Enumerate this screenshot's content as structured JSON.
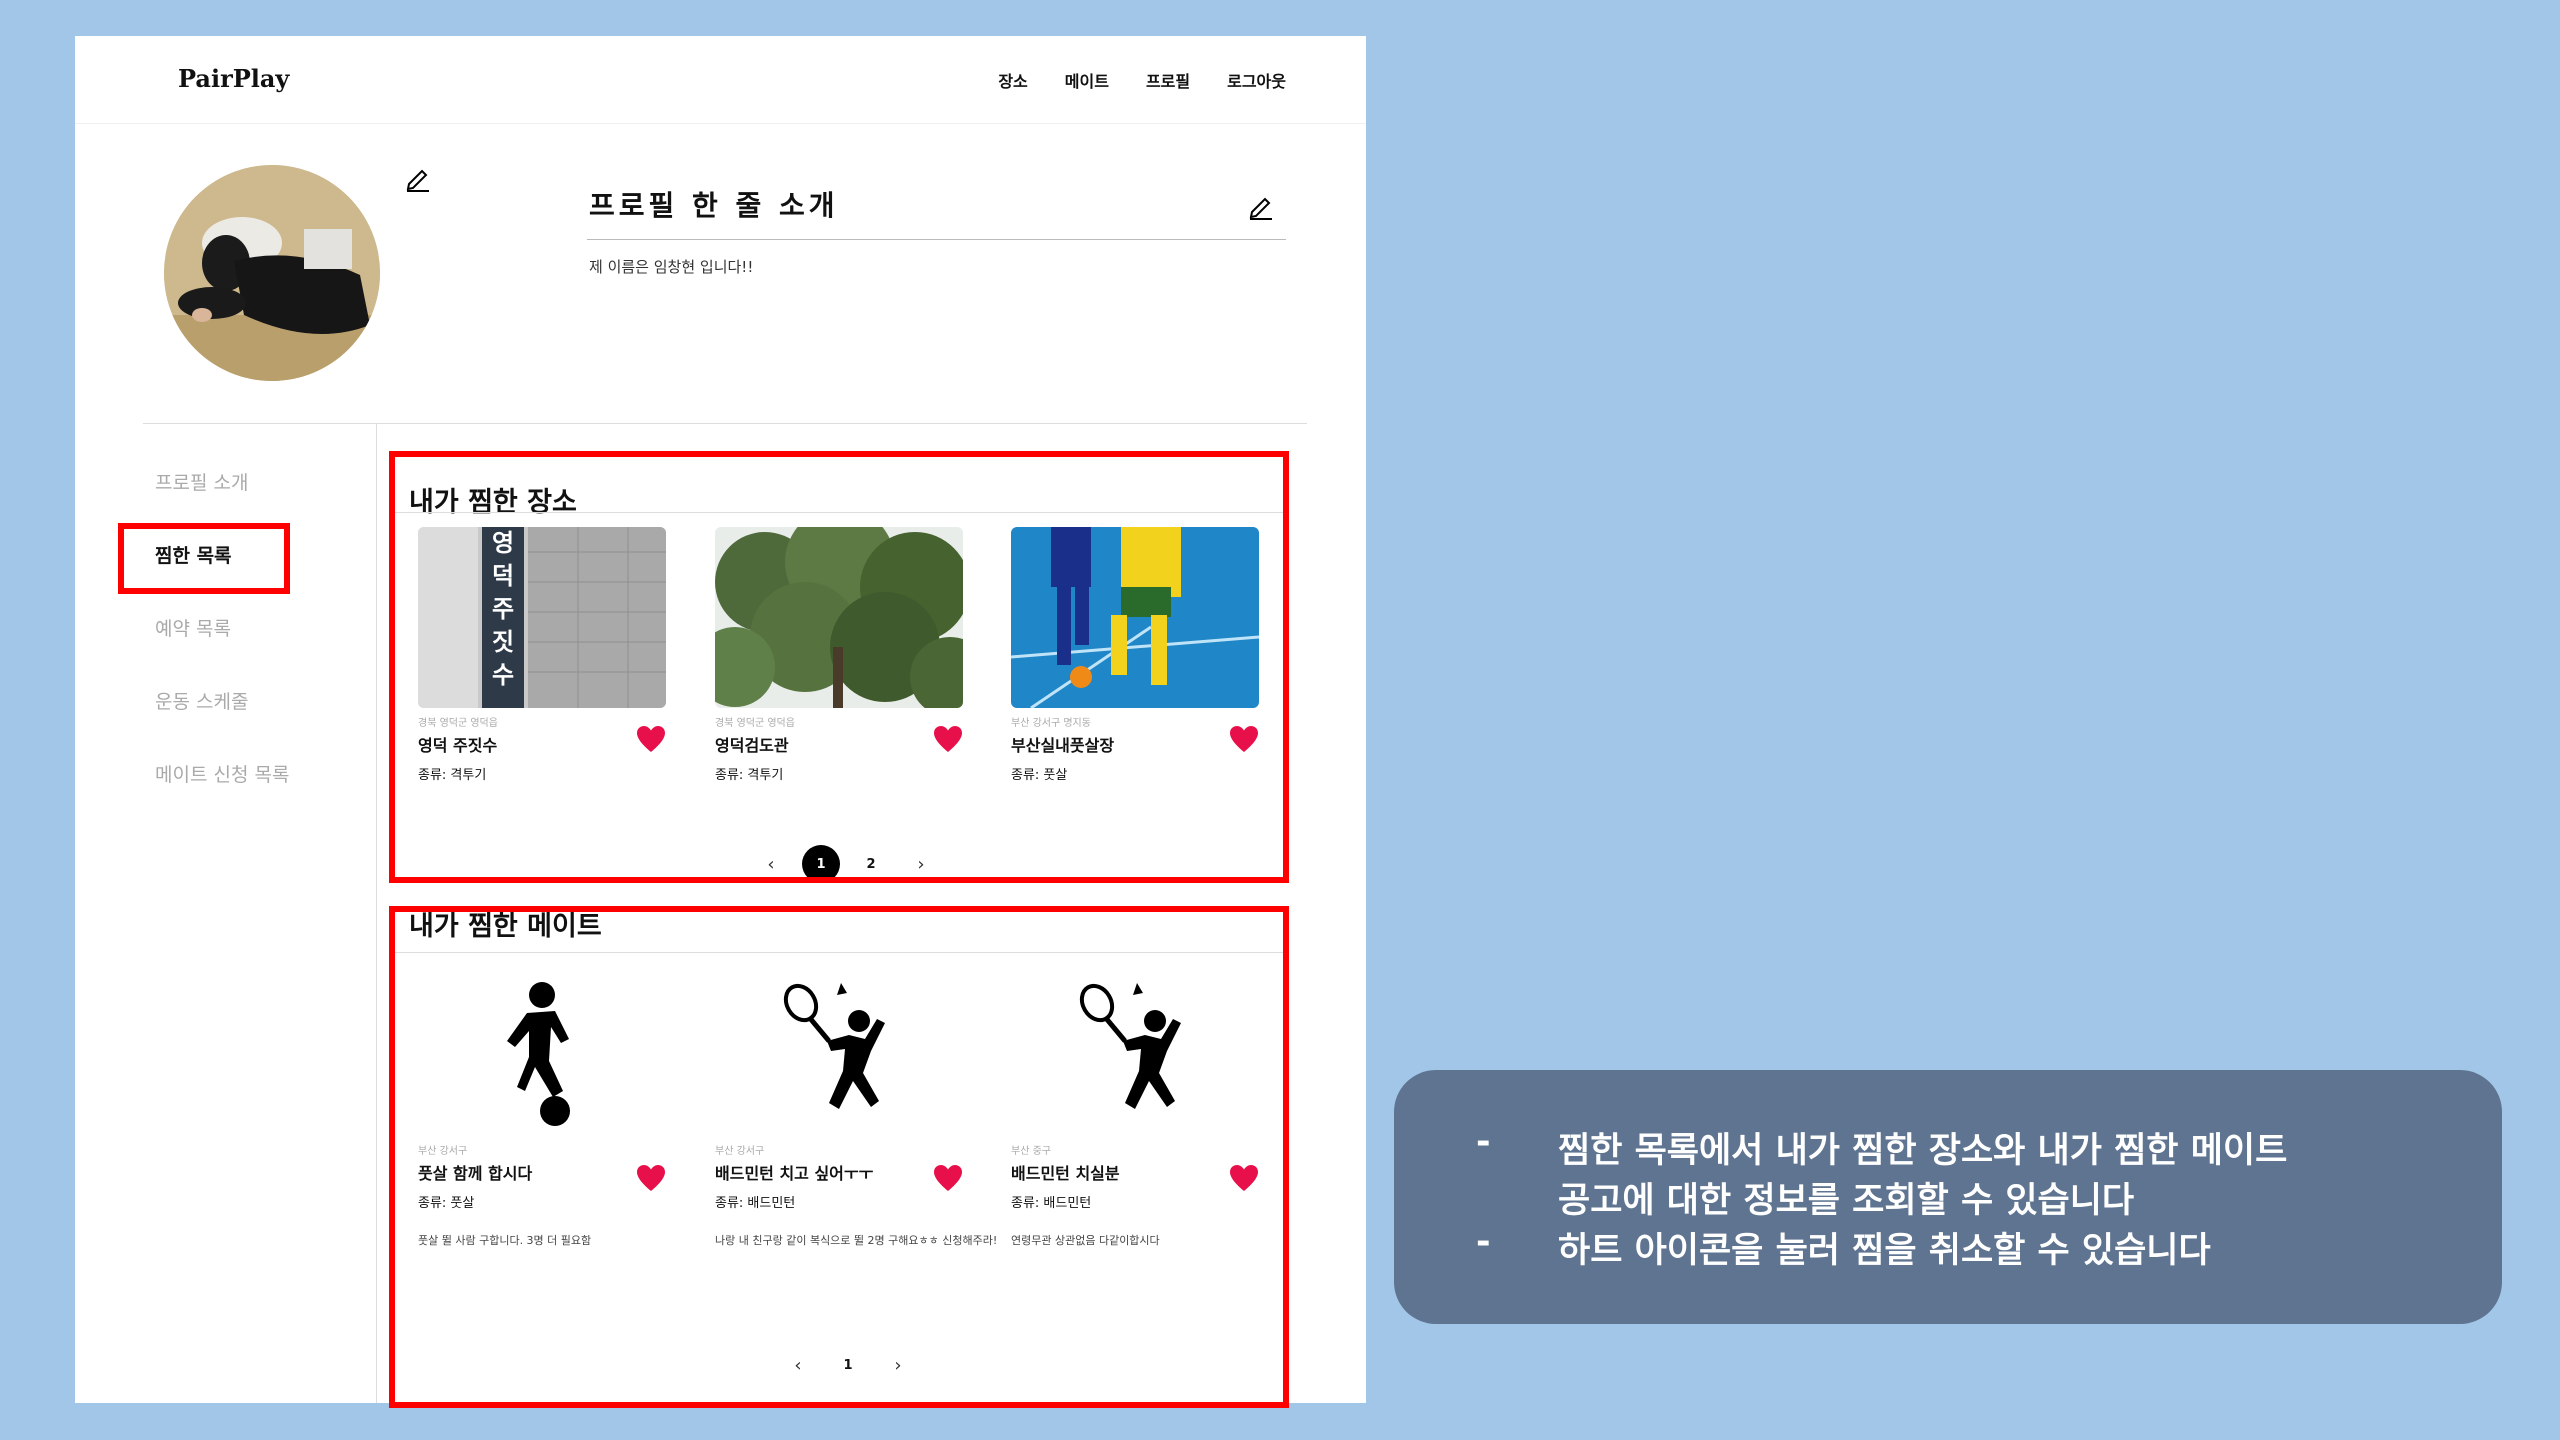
{
  "app": {
    "logo": "PairPlay"
  },
  "nav": [
    "장소",
    "메이트",
    "프로필",
    "로그아웃"
  ],
  "profile": {
    "intro_title": "프로필 한 줄 소개",
    "intro_text": "제 이름은 임창현 입니다!!"
  },
  "sidebar": [
    {
      "label": "프로필 소개",
      "active": false
    },
    {
      "label": "찜한 목록",
      "active": true
    },
    {
      "label": "예약 목록",
      "active": false
    },
    {
      "label": "운동 스케줄",
      "active": false
    },
    {
      "label": "메이트 신청 목록",
      "active": false
    }
  ],
  "places": {
    "title": "내가 찜한 장소",
    "items": [
      {
        "location": "경북 영덕군 영덕읍",
        "name": "영덕 주짓수",
        "type": "종류: 격투기",
        "sign_text": "영덕주짓수"
      },
      {
        "location": "경북 영덕군 영덕읍",
        "name": "영덕검도관",
        "type": "종류: 격투기"
      },
      {
        "location": "부산 강서구 명지동",
        "name": "부산실내풋살장",
        "type": "종류: 풋살"
      }
    ],
    "pages": [
      "1",
      "2"
    ],
    "active_page": "1"
  },
  "mates": {
    "title": "내가 찜한 메이트",
    "items": [
      {
        "location": "부산 강서구",
        "name": "풋살 함께 합시다",
        "type": "종류: 풋살",
        "desc": "풋살 뛸 사람 구합니다. 3명 더 필요함",
        "icon": "soccer-player-icon"
      },
      {
        "location": "부산 강서구",
        "name": "배드민턴 치고 싶어ㅜㅜ",
        "type": "종류: 배드민턴",
        "desc": "나랑 내 친구랑 같이 복식으로 뛸 2명 구해요ㅎㅎ 신청해주라!",
        "icon": "badminton-player-icon"
      },
      {
        "location": "부산 중구",
        "name": "배드민턴 치실분",
        "type": "종류: 배드민턴",
        "desc": "연령무관 상관없음 다같이합시다",
        "icon": "badminton-player-icon"
      }
    ],
    "pages": [
      "1"
    ],
    "active_page": "1"
  },
  "callout": {
    "dash": "-",
    "line1": "찜한 목록에서 내가 찜한 장소와 내가 찜한 메이트",
    "line2": "공고에 대한 정보를 조회할 수 있습니다",
    "line3": "하트 아이콘을 눌러 찜을 취소할 수 있습니다"
  },
  "colors": {
    "heart": "#e8104a",
    "highlight": "#ff0000",
    "background": "#a2c6e8",
    "callout": "#5e7490"
  }
}
